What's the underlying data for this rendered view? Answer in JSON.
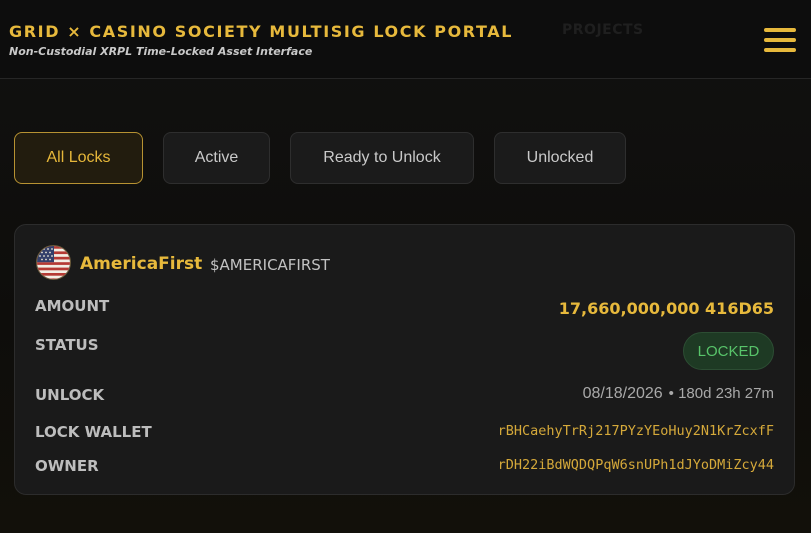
{
  "header": {
    "title": "GRID × CASINO SOCIETY MULTISIG LOCK PORTAL",
    "subtitle": "Non-Custodial XRPL Time-Locked Asset Interface",
    "nav_projects": "PROJECTS",
    "menu_icon": "hamburger-menu-icon"
  },
  "filters": [
    {
      "label": "All Locks",
      "active": true
    },
    {
      "label": "Active",
      "active": false
    },
    {
      "label": "Ready to Unlock",
      "active": false
    },
    {
      "label": "Unlocked",
      "active": false
    }
  ],
  "lock_card": {
    "avatar_icon": "us-flag-icon",
    "name": "AmericaFirst",
    "ticker": "$AMERICAFIRST",
    "labels": {
      "amount": "AMOUNT",
      "status": "STATUS",
      "unlock": "UNLOCK",
      "lock_wallet": "LOCK WALLET",
      "owner": "OWNER"
    },
    "amount": "17,660,000,000 416D65",
    "status": "LOCKED",
    "unlock_date": "08/18/2026",
    "unlock_remaining": "• 180d 23h 27m",
    "lock_wallet": "rBHCaehyTrRj217PYzYEoHuy2N1KrZcxfF",
    "owner": "rDH22iBdWQDQPqW6snUPh1dJYoDMiZcy44"
  },
  "colors": {
    "accent_gold": "#e7b93c",
    "status_green": "#58c46a",
    "background": "#0e0d0b"
  }
}
